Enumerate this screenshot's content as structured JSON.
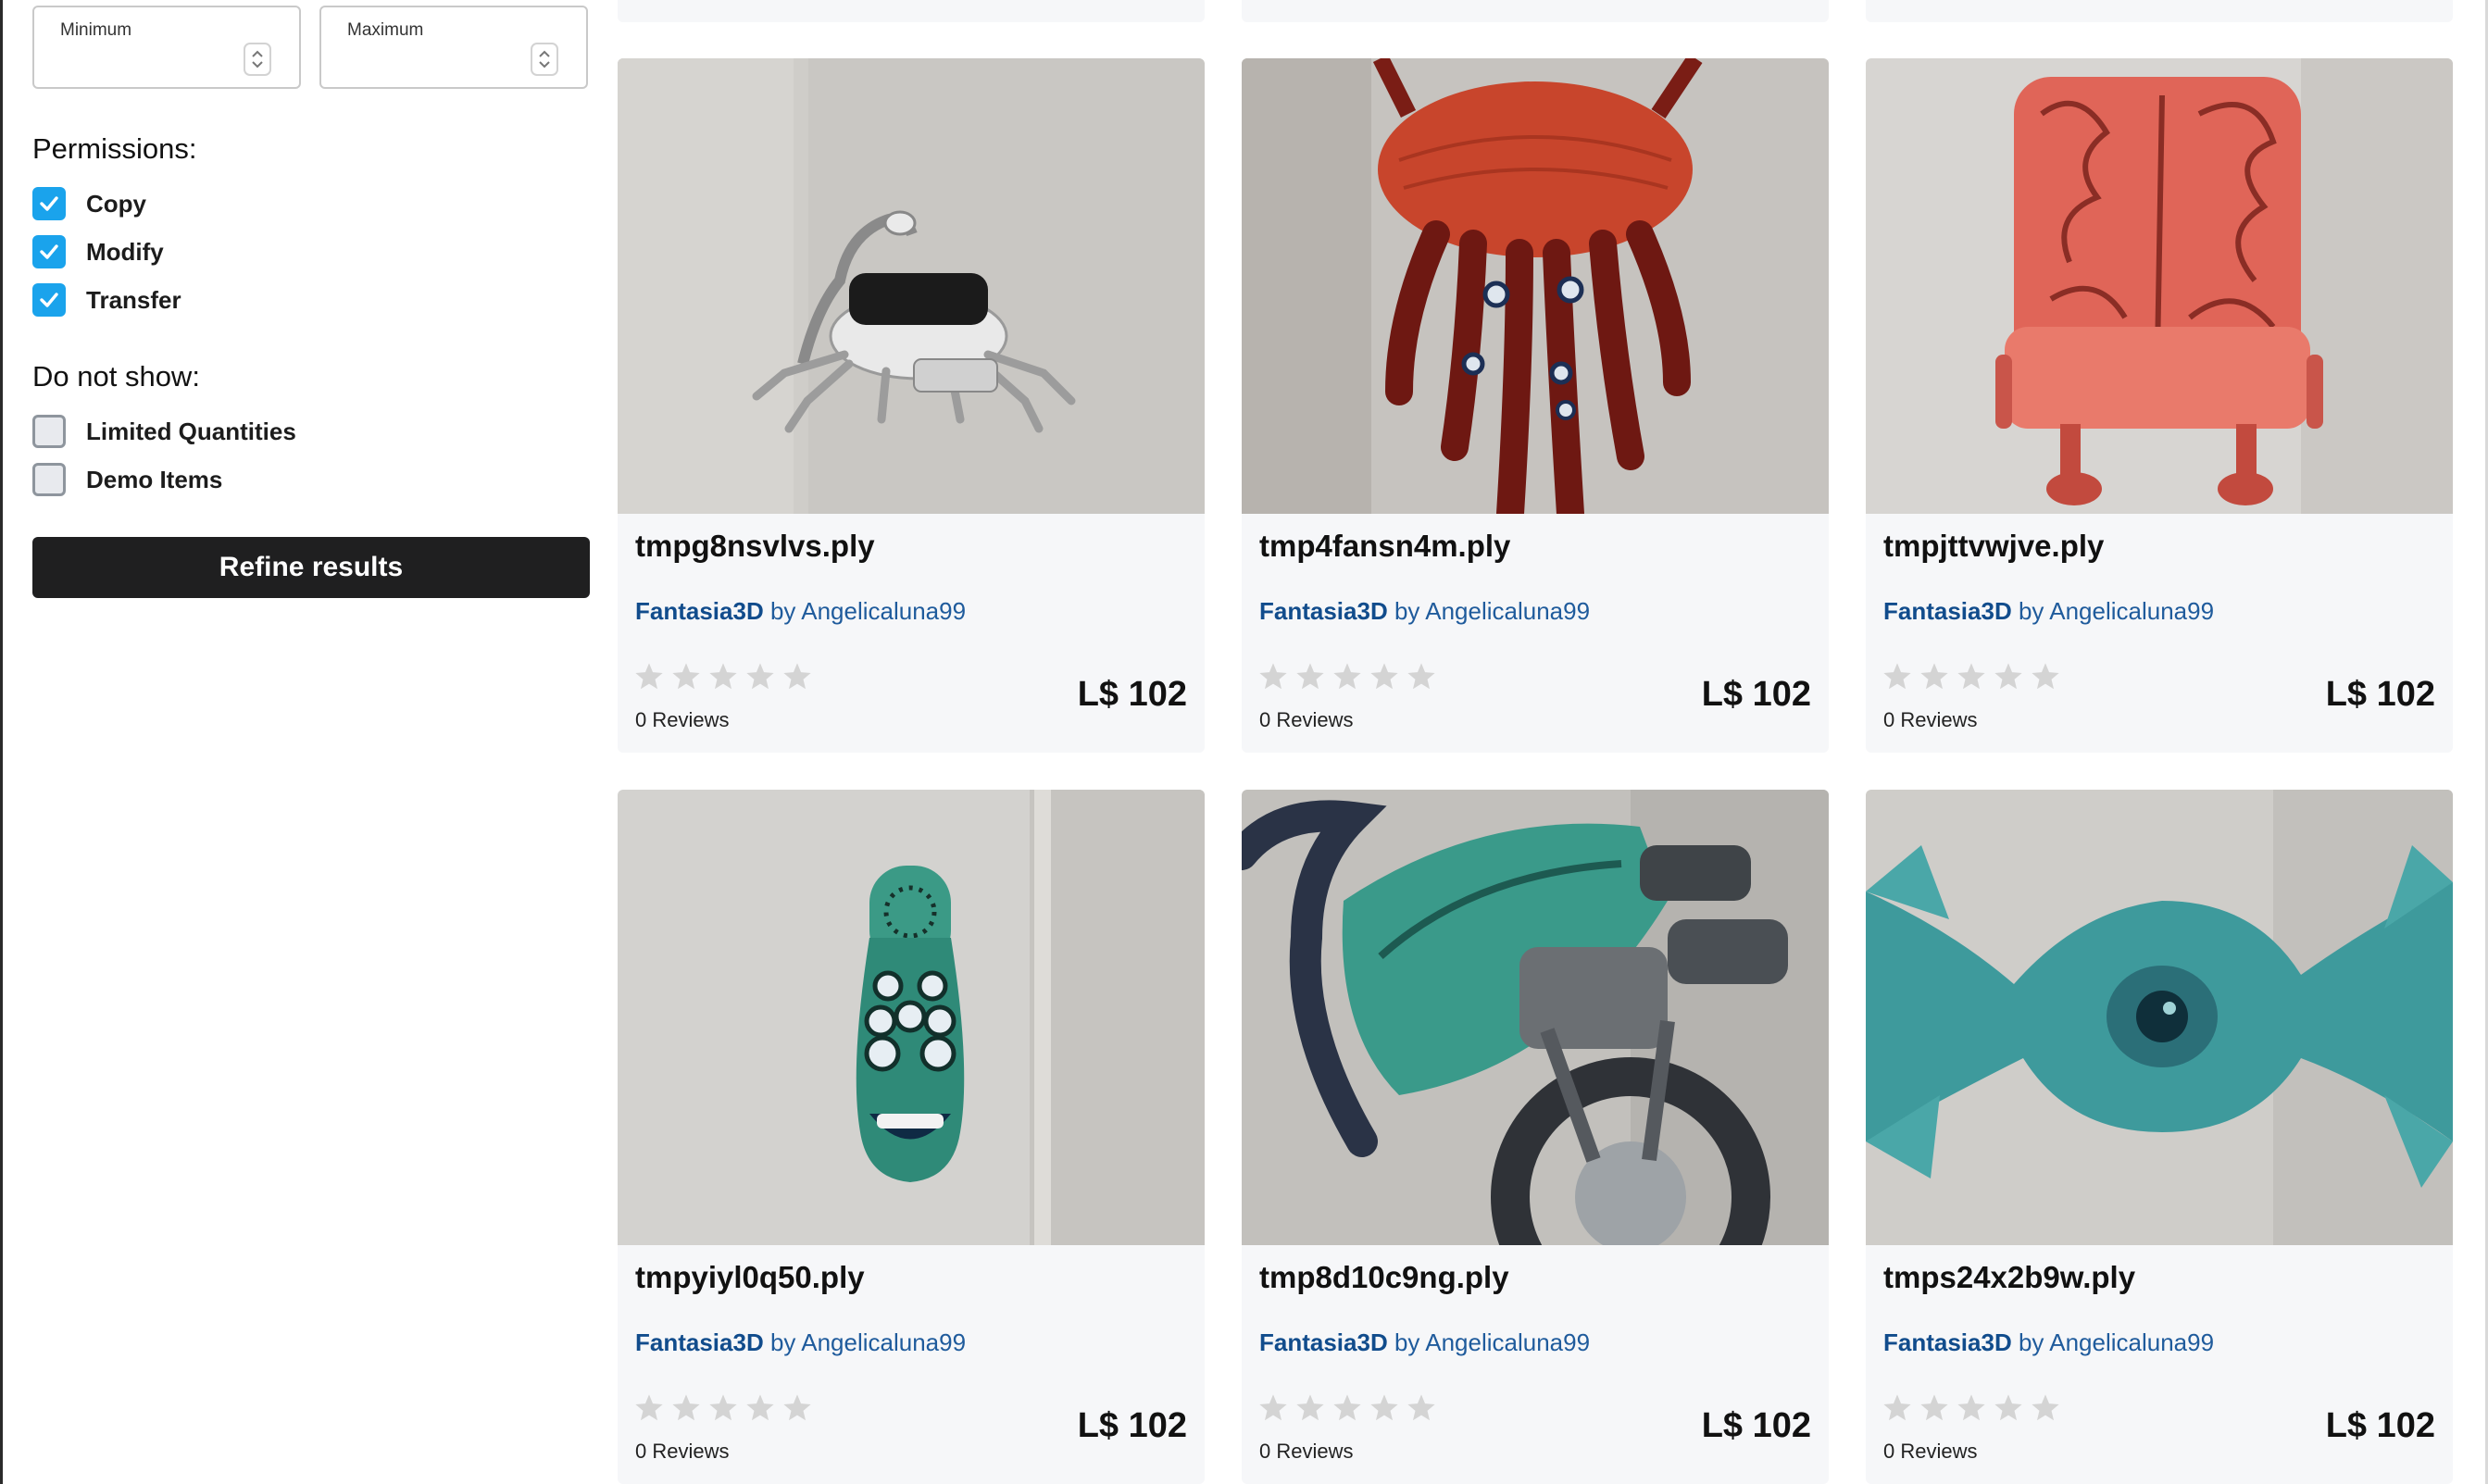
{
  "filters": {
    "price": {
      "min_label": "Minimum",
      "max_label": "Maximum",
      "min_value": "",
      "max_value": ""
    },
    "permissions_title": "Permissions:",
    "permissions": [
      {
        "label": "Copy",
        "checked": true
      },
      {
        "label": "Modify",
        "checked": true
      },
      {
        "label": "Transfer",
        "checked": true
      }
    ],
    "do_not_show_title": "Do not show:",
    "do_not_show": [
      {
        "label": "Limited Quantities",
        "checked": false
      },
      {
        "label": "Demo Items",
        "checked": false
      }
    ],
    "refine_label": "Refine results"
  },
  "colors": {
    "checkbox_checked": "#1aa3ec",
    "store_link": "#114c8c",
    "button_bg": "#1f1f20"
  },
  "listing": {
    "by_text": "by",
    "products": [
      {
        "title": "tmpg8nsvlvs.ply",
        "store": "Fantasia3D",
        "creator": "Angelicaluna99",
        "rating": 0,
        "reviews": "0 Reviews",
        "price": "L$ 102",
        "thumb_icon": "scorpion-robot-model"
      },
      {
        "title": "tmp4fansn4m.ply",
        "store": "Fantasia3D",
        "creator": "Angelicaluna99",
        "rating": 0,
        "reviews": "0 Reviews",
        "price": "L$ 102",
        "thumb_icon": "red-tentacle-creature-model"
      },
      {
        "title": "tmpjttvwjve.ply",
        "store": "Fantasia3D",
        "creator": "Angelicaluna99",
        "rating": 0,
        "reviews": "0 Reviews",
        "price": "L$ 102",
        "thumb_icon": "brain-chair-model"
      },
      {
        "title": "tmpyiyl0q50.ply",
        "store": "Fantasia3D",
        "creator": "Angelicaluna99",
        "rating": 0,
        "reviews": "0 Reviews",
        "price": "L$ 102",
        "thumb_icon": "phone-handset-creature-model"
      },
      {
        "title": "tmp8d10c9ng.ply",
        "store": "Fantasia3D",
        "creator": "Angelicaluna99",
        "rating": 0,
        "reviews": "0 Reviews",
        "price": "L$ 102",
        "thumb_icon": "teal-motorbike-model"
      },
      {
        "title": "tmps24x2b9w.ply",
        "store": "Fantasia3D",
        "creator": "Angelicaluna99",
        "rating": 0,
        "reviews": "0 Reviews",
        "price": "L$ 102",
        "thumb_icon": "teal-eye-candy-model"
      }
    ]
  }
}
